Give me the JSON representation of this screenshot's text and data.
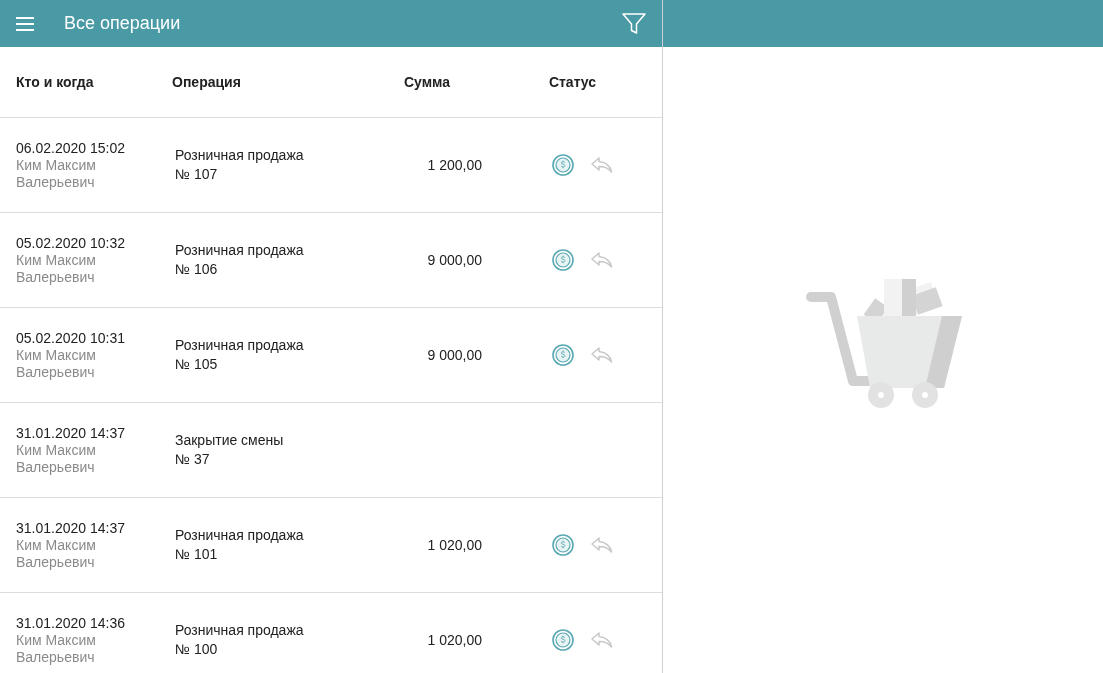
{
  "toolbar": {
    "title": "Все операции"
  },
  "table": {
    "columns": [
      "Кто и когда",
      "Операция",
      "Сумма",
      "Статус"
    ],
    "rows": [
      {
        "kind": "sale",
        "datetime": "06.02.2020 15:02",
        "person": "Ким Максим Валерьевич",
        "operation": "Розничная продажа",
        "number": "№ 107",
        "amount": "1 200,00"
      },
      {
        "kind": "sale",
        "datetime": "05.02.2020 10:32",
        "person": "Ким Максим Валерьевич",
        "operation": "Розничная продажа",
        "number": "№ 106",
        "amount": "9 000,00"
      },
      {
        "kind": "sale",
        "datetime": "05.02.2020 10:31",
        "person": "Ким Максим Валерьевич",
        "operation": "Розничная продажа",
        "number": "№ 105",
        "amount": "9 000,00"
      },
      {
        "kind": "shift",
        "datetime": "31.01.2020 14:37",
        "person": "Ким Максим Валерьевич",
        "operation": "Закрытие смены",
        "number": "№ 37"
      },
      {
        "kind": "sale",
        "datetime": "31.01.2020 14:37",
        "person": "Ким Максим Валерьевич",
        "operation": "Розничная продажа",
        "number": "№ 101",
        "amount": "1 020,00"
      },
      {
        "kind": "sale",
        "datetime": "31.01.2020 14:36",
        "person": "Ким Максим Валерьевич",
        "operation": "Розничная продажа",
        "number": "№ 100",
        "amount": "1 020,00"
      }
    ]
  }
}
